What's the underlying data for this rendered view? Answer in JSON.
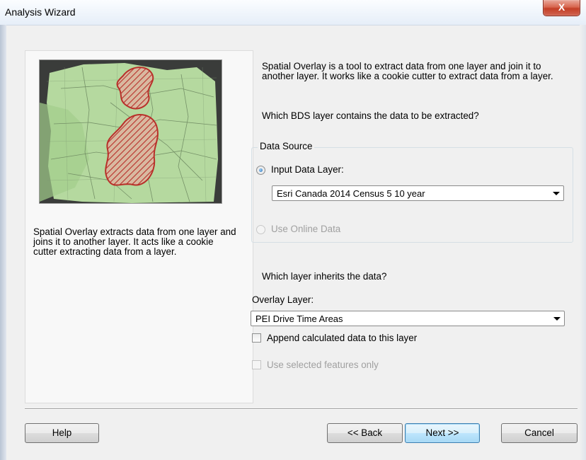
{
  "window": {
    "title": "Analysis Wizard",
    "close_glyph": "X"
  },
  "left": {
    "description": "Spatial Overlay extracts data from one layer and joins it to another layer. It acts like a cookie cutter extracting data from a layer."
  },
  "main": {
    "intro": "Spatial Overlay is a tool to extract data from one layer and join it to another layer. It works like a cookie cutter to extract data from a layer.",
    "question1": "Which BDS layer contains the data to be extracted?",
    "data_source": {
      "group_label": "Data Source",
      "input_label": "Input Data Layer:",
      "input_value": "Esri Canada 2014 Census 5 10 year",
      "online_label": "Use Online Data"
    },
    "question2": "Which layer inherits the data?",
    "overlay_label": "Overlay Layer:",
    "overlay_value": "PEI Drive Time Areas",
    "append_label": "Append calculated data to this layer",
    "selected_label": "Use selected features only"
  },
  "buttons": {
    "help": "Help",
    "back": "<< Back",
    "next": "Next >>",
    "cancel": "Cancel"
  },
  "colors": {
    "map_fill": "#b7dba0",
    "overlay_red": "#b8302a"
  }
}
